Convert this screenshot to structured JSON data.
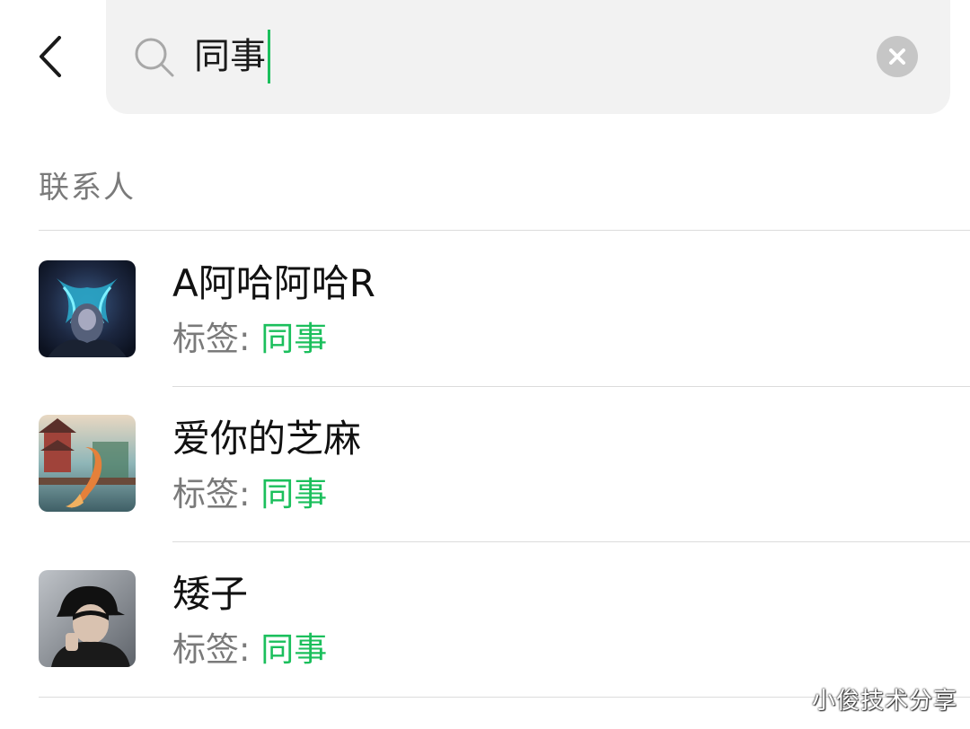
{
  "search": {
    "query": "同事"
  },
  "section": {
    "title": "联系人"
  },
  "contacts": [
    {
      "name": "A阿哈阿哈R",
      "tag_label": "标签: ",
      "tag_value": "同事"
    },
    {
      "name": "爱你的芝麻",
      "tag_label": "标签: ",
      "tag_value": "同事"
    },
    {
      "name": "矮子",
      "tag_label": "标签: ",
      "tag_value": "同事"
    }
  ],
  "watermark": "小俊技术分享",
  "colors": {
    "accent": "#1bbf5c",
    "search_bg": "#f2f2f2",
    "section_title": "#7a7a7a",
    "divider": "#dcdcdc"
  },
  "icons": {
    "back": "chevron-left-icon",
    "search": "search-icon",
    "clear": "clear-icon"
  }
}
